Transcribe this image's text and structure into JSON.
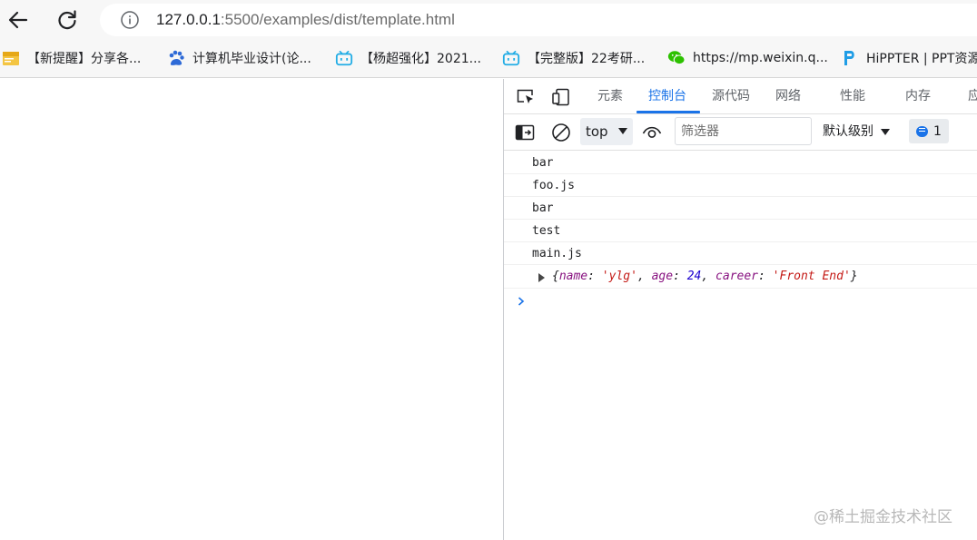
{
  "address": {
    "host": "127.0.0.1",
    "path": ":5500/examples/dist/template.html"
  },
  "bookmarks": [
    {
      "label": "【新提醒】分享各...",
      "icon": "folder-note-icon"
    },
    {
      "label": "计算机毕业设计(论...",
      "icon": "baidu-paw-icon"
    },
    {
      "label": "【杨超强化】2021...",
      "icon": "bilibili-icon"
    },
    {
      "label": "【完整版】22考研...",
      "icon": "bilibili-icon"
    },
    {
      "label": "https://mp.weixin.q...",
      "icon": "wechat-icon"
    },
    {
      "label": "HiPPTER | PPT资源",
      "icon": "hippter-icon"
    }
  ],
  "devtools": {
    "tabs": [
      "元素",
      "控制台",
      "源代码",
      "网络",
      "性能",
      "内存",
      "应"
    ],
    "active_tab": "控制台",
    "context_selector": "top",
    "filter_placeholder": "筛选器",
    "levels_label": "默认级别",
    "issues_count": "1"
  },
  "console": {
    "lines": [
      "bar",
      "foo.js",
      "bar",
      "test",
      "main.js"
    ],
    "object": {
      "open": "{",
      "k1": "name",
      "v1": "'ylg'",
      "k2": "age",
      "v2": "24",
      "k3": "career",
      "v3": "'Front End'",
      "close": "}"
    }
  },
  "watermark": "@稀土掘金技术社区",
  "colors": {
    "accent": "#1a73e8",
    "property": "#881280",
    "string": "#c41a16",
    "number": "#1c00cf"
  }
}
